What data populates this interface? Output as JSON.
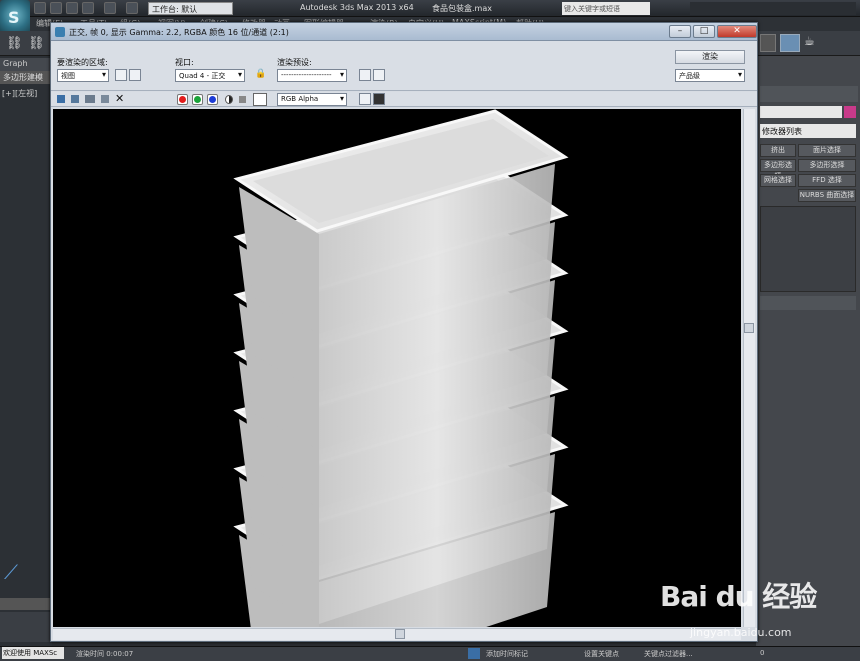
{
  "app": {
    "logo_letter": "S",
    "workspace_label": "工作台: 默认",
    "app_title": "Autodesk 3ds Max  2013 x64",
    "file_title": "食品包装盒.max",
    "search_placeholder": "键入关键字或短语"
  },
  "menubar": {
    "items": [
      "编辑(E)",
      "工具(T)",
      "组(G)",
      "视图(V)",
      "创建(C)",
      "修改器",
      "动画",
      "图形编辑器",
      "渲染(R)",
      "自定义(U)",
      "MAXScript(M)",
      "帮助(H)"
    ]
  },
  "left_panel": {
    "graph_tab": "Graph",
    "poly_tab": "多边形建模",
    "viewport_label": "[+][左视]"
  },
  "right_panel": {
    "modifier_list": "修改器列表",
    "buttons": [
      "挤出",
      "面片选择",
      "多边形选择",
      "多边形选择",
      "网格选择",
      "FFD 选择",
      "NURBS 曲面选择"
    ]
  },
  "render_window": {
    "title": "正交, 帧 0, 显示 Gamma: 2.2, RGBA 颜色 16 位/通道 (2:1)",
    "area_label": "要渲染的区域:",
    "area_value": "视图",
    "viewport_label": "视口:",
    "viewport_value": "Quad 4 - 正交",
    "preset_label": "渲染预设:",
    "preset_value": "--------------------",
    "render_button": "渲染",
    "quality_value": "产品级",
    "channel_value": "RGB Alpha"
  },
  "status": {
    "welcome": "欢迎使用 MAXSc",
    "render_time": "渲染时间  0:00:07",
    "add_time_tag": "添加时间标记",
    "set_key": "设置关键点",
    "key_filter": "关键点过滤器...",
    "frame": "0"
  },
  "watermark": {
    "brand": "Bai du 经验",
    "url": "jingyan.baidu.com"
  },
  "colors": {
    "accent": "#c8d4e3",
    "canvas_bg": "#000000",
    "box": "#e8e8e8"
  }
}
